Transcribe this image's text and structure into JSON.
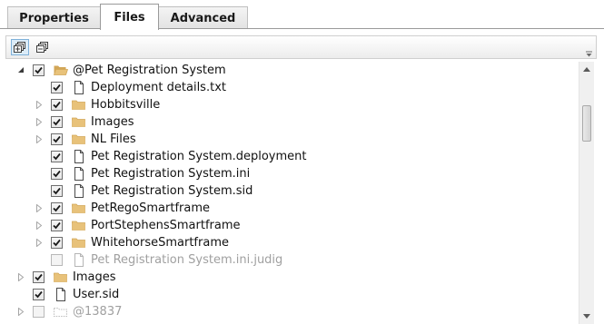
{
  "tabs": [
    {
      "label": "Properties",
      "active": false
    },
    {
      "label": "Files",
      "active": true
    },
    {
      "label": "Advanced",
      "active": false
    }
  ],
  "toolbar": {
    "buttons": [
      {
        "name": "expand-all-icon",
        "pressed": true
      },
      {
        "name": "collapse-all-icon",
        "pressed": false
      }
    ]
  },
  "tree": [
    {
      "label": "@Pet Registration System",
      "type": "folder-open",
      "level": 0,
      "expander": "expanded",
      "checked": true,
      "disabled": false
    },
    {
      "label": "Deployment details.txt",
      "type": "file",
      "level": 1,
      "expander": "none",
      "checked": true,
      "disabled": false
    },
    {
      "label": "Hobbitsville",
      "type": "folder",
      "level": 1,
      "expander": "collapsed",
      "checked": true,
      "disabled": false
    },
    {
      "label": "Images",
      "type": "folder",
      "level": 1,
      "expander": "collapsed",
      "checked": true,
      "disabled": false
    },
    {
      "label": "NL Files",
      "type": "folder",
      "level": 1,
      "expander": "collapsed",
      "checked": true,
      "disabled": false
    },
    {
      "label": "Pet Registration System.deployment",
      "type": "file",
      "level": 1,
      "expander": "none",
      "checked": true,
      "disabled": false
    },
    {
      "label": "Pet Registration System.ini",
      "type": "file",
      "level": 1,
      "expander": "none",
      "checked": true,
      "disabled": false
    },
    {
      "label": "Pet Registration System.sid",
      "type": "file",
      "level": 1,
      "expander": "none",
      "checked": true,
      "disabled": false
    },
    {
      "label": "PetRegoSmartframe",
      "type": "folder",
      "level": 1,
      "expander": "collapsed",
      "checked": true,
      "disabled": false
    },
    {
      "label": "PortStephensSmartframe",
      "type": "folder",
      "level": 1,
      "expander": "collapsed",
      "checked": true,
      "disabled": false
    },
    {
      "label": "WhitehorseSmartframe",
      "type": "folder",
      "level": 1,
      "expander": "collapsed",
      "checked": true,
      "disabled": false
    },
    {
      "label": "Pet Registration System.ini.judig",
      "type": "file",
      "level": 1,
      "expander": "none",
      "checked": false,
      "disabled": true
    },
    {
      "label": "Images",
      "type": "folder",
      "level": 0,
      "expander": "collapsed",
      "checked": true,
      "disabled": false
    },
    {
      "label": "User.sid",
      "type": "file",
      "level": 0,
      "expander": "none",
      "checked": true,
      "disabled": false
    },
    {
      "label": "@13837",
      "type": "folder-ghost",
      "level": 0,
      "expander": "collapsed",
      "checked": false,
      "disabled": true
    }
  ],
  "colors": {
    "folder": "#e8c27a",
    "folder_dark": "#d2a657",
    "check": "#1a1a1a",
    "disabled_text": "#a0a0a0",
    "accent": "#7fb1d9"
  }
}
